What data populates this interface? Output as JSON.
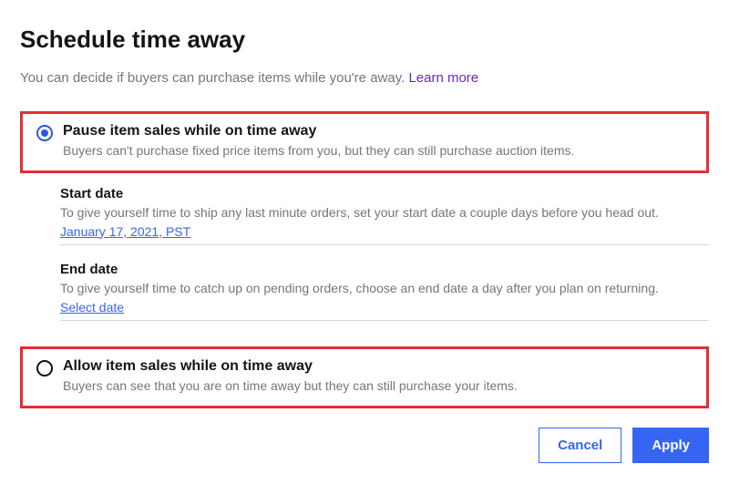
{
  "title": "Schedule time away",
  "intro": {
    "text": "You can decide if buyers can purchase items while you're away. ",
    "learn_more": "Learn more"
  },
  "options": {
    "pause": {
      "title": "Pause item sales while on time away",
      "desc": "Buyers can't purchase fixed price items from you, but they can still purchase auction items."
    },
    "allow": {
      "title": "Allow item sales while on time away",
      "desc": "Buyers can see that you are on time away but they can still purchase your items."
    }
  },
  "dates": {
    "start": {
      "label": "Start date",
      "hint": "To give yourself time to ship any last minute orders, set your start date a couple days before you head out.",
      "value": "January 17, 2021, PST"
    },
    "end": {
      "label": "End date",
      "hint": "To give yourself time to catch up on pending orders, choose an end date a day after you plan on returning.",
      "value": "Select date"
    }
  },
  "actions": {
    "cancel": "Cancel",
    "apply": "Apply"
  }
}
